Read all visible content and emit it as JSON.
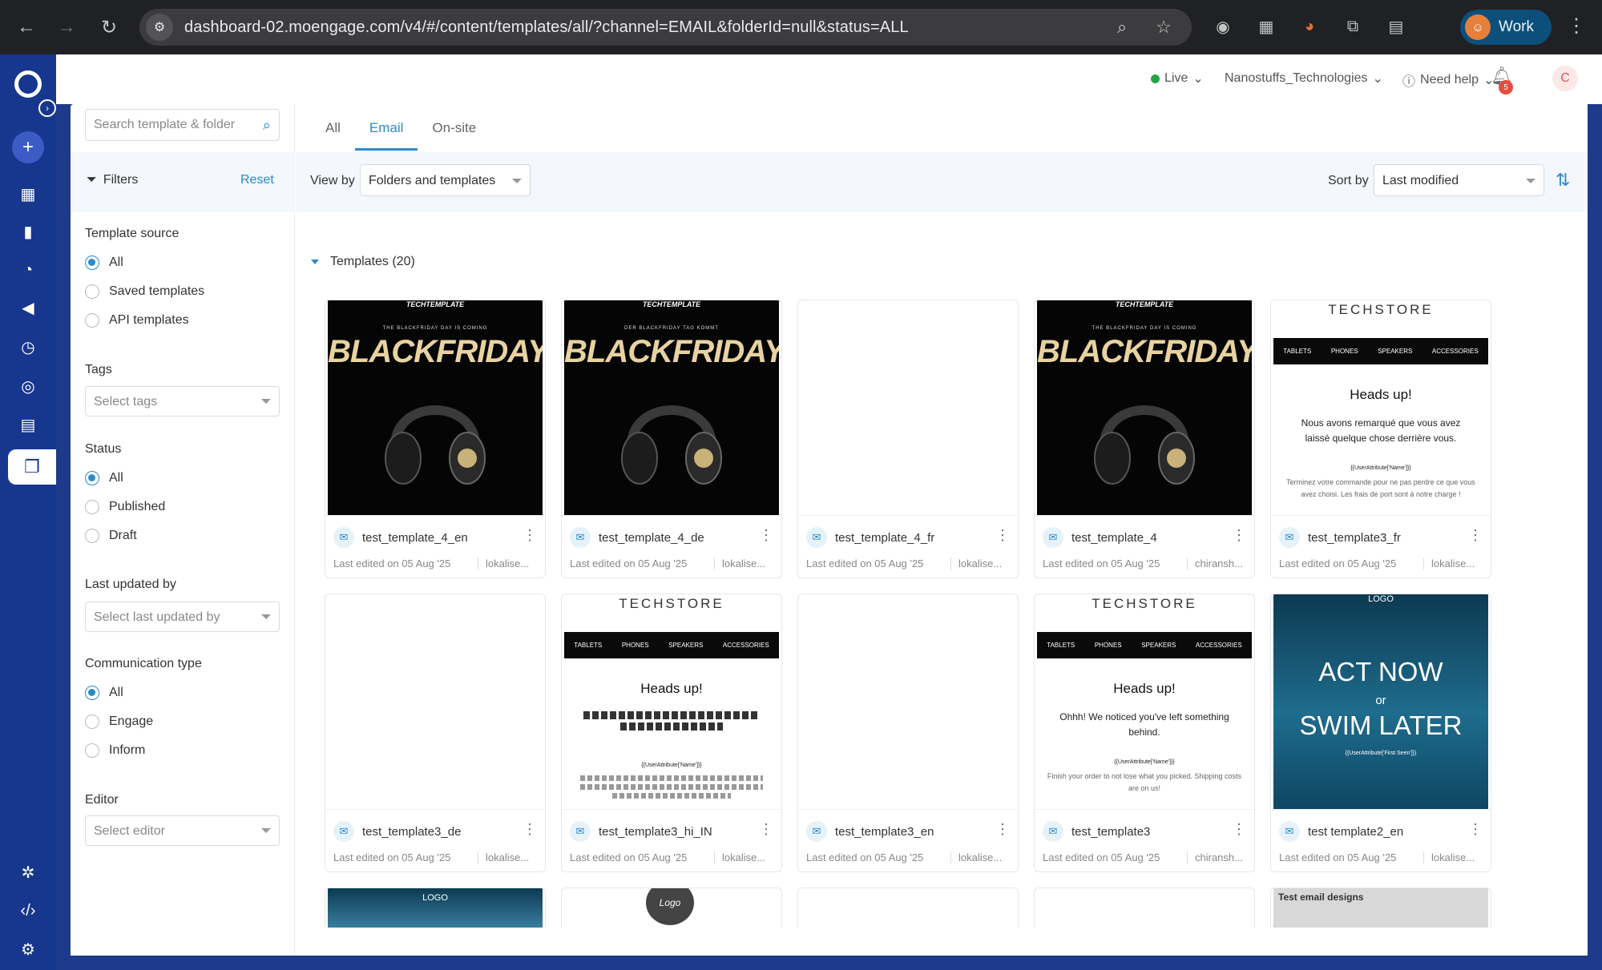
{
  "browser": {
    "url": "dashboard-02.moengage.com/v4/#/content/templates/all/?channel=EMAIL&folderId=null&status=ALL",
    "profile_name": "Work"
  },
  "topbar": {
    "env_label": "Live",
    "workspace": "Nanostuffs_Technologies",
    "help_label": "Need help",
    "notifications": "5",
    "user_initial": "C"
  },
  "search": {
    "placeholder": "Search template & folder"
  },
  "filters": {
    "title": "Filters",
    "reset_label": "Reset",
    "template_source": {
      "title": "Template source",
      "options": [
        "All",
        "Saved templates",
        "API templates"
      ]
    },
    "tags": {
      "title": "Tags",
      "placeholder": "Select tags"
    },
    "status": {
      "title": "Status",
      "options": [
        "All",
        "Published",
        "Draft"
      ]
    },
    "last_updated_by": {
      "title": "Last updated by",
      "placeholder": "Select last updated by"
    },
    "communication_type": {
      "title": "Communication type",
      "options": [
        "All",
        "Engage",
        "Inform"
      ]
    },
    "editor": {
      "title": "Editor",
      "placeholder": "Select editor"
    }
  },
  "tabs": [
    "All",
    "Email",
    "On-site"
  ],
  "toolbar": {
    "view_by_label": "View by",
    "view_by_value": "Folders and templates",
    "sort_by_label": "Sort by",
    "sort_by_value": "Last modified"
  },
  "templates_header": "Templates (20)",
  "thumbs": {
    "bf_brand": "TECHTEMPLATE",
    "bf_sub_en": "THE BLACKFRIDAY DAY IS COMING",
    "bf_sub_de": "DER BLACKFRIDAY TAG KOMMT",
    "bf_title": "BLACKFRIDAY",
    "ts_logo": "TECHSTORE",
    "ts_nav": [
      "TABLETS",
      "PHONES",
      "SPEAKERS",
      "ACCESSORIES"
    ],
    "ts_heads": "Heads up!",
    "ts_fr_msg": "Nous avons remarqué que vous avez laissé quelque chose derrière vous.",
    "ts_attr": "{{UserAttribute['Name']}}",
    "ts_fr_small": "Terminez votre commande pour ne pas perdre ce que vous avez choisi. Les frais de port sont à notre charge !",
    "ts_en_msg": "Ohhh! We noticed you've left something behind.",
    "ts_en_small": "Finish your order to not lose what you picked. Shipping costs are on us!",
    "act_logo": "LOGO",
    "act_l1": "ACT NOW",
    "act_l2": "or",
    "act_l3": "SWIM LATER",
    "act_attr": "{{UserAttribute['First Seen']}}",
    "your_logo": "Logo",
    "test_email": "Test email designs"
  },
  "cards": [
    {
      "name": "test_template_4_en",
      "edited": "Last edited on 05 Aug '25",
      "by": "lokalise..."
    },
    {
      "name": "test_template_4_de",
      "edited": "Last edited on 05 Aug '25",
      "by": "lokalise..."
    },
    {
      "name": "test_template_4_fr",
      "edited": "Last edited on 05 Aug '25",
      "by": "lokalise..."
    },
    {
      "name": "test_template_4",
      "edited": "Last edited on 05 Aug '25",
      "by": "chiransh..."
    },
    {
      "name": "test_template3_fr",
      "edited": "Last edited on 05 Aug '25",
      "by": "lokalise..."
    },
    {
      "name": "test_template3_de",
      "edited": "Last edited on 05 Aug '25",
      "by": "lokalise..."
    },
    {
      "name": "test_template3_hi_IN",
      "edited": "Last edited on 05 Aug '25",
      "by": "lokalise..."
    },
    {
      "name": "test_template3_en",
      "edited": "Last edited on 05 Aug '25",
      "by": "lokalise..."
    },
    {
      "name": "test_template3",
      "edited": "Last edited on 05 Aug '25",
      "by": "chiransh..."
    },
    {
      "name": "test template2_en",
      "edited": "Last edited on 05 Aug '25",
      "by": "lokalise..."
    }
  ],
  "colors": {
    "accent": "#2a8bc9",
    "rail": "#17378e",
    "live": "#22a447"
  }
}
